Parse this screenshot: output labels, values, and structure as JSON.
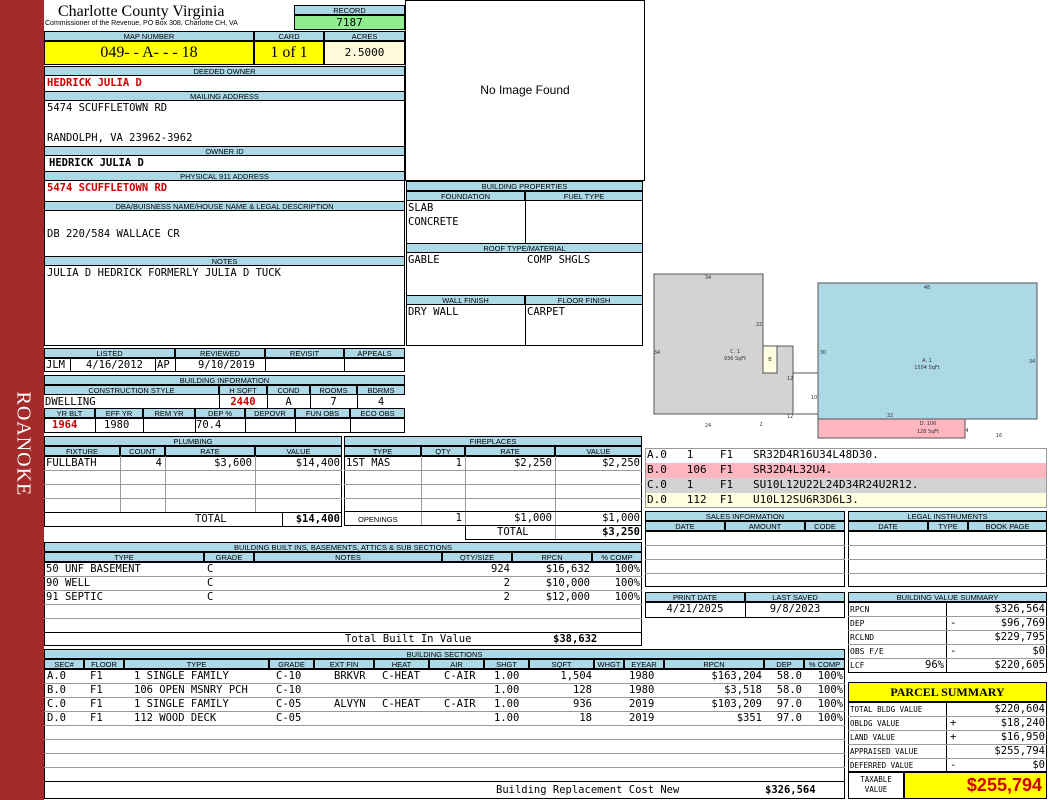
{
  "sidebar_label": "ROANOKE",
  "header": {
    "county": "Charlotte County Virginia",
    "commissioner": "Commissioner of the Revenue, PO Box 308, Charlotte CH, VA",
    "record_label": "RECORD",
    "record": "7187",
    "map_number_label": "MAP NUMBER",
    "map_number": "049- - A- - - 18",
    "card_label": "CARD",
    "card": "1 of 1",
    "acres_label": "ACRES",
    "acres": "2.5000"
  },
  "owner": {
    "deeded_owner_label": "DEEDED OWNER",
    "deeded_owner": "HEDRICK JULIA D",
    "mailing_label": "MAILING ADDRESS",
    "mailing_line1": "5474 SCUFFLETOWN RD",
    "mailing_line2": "RANDOLPH, VA 23962-3962",
    "owner_id_label": "OWNER ID",
    "owner_id": "HEDRICK JULIA D",
    "physical_label": "PHYSICAL 911 ADDRESS",
    "physical": "5474 SCUFFLETOWN RD",
    "dba_label": "DBA/BUISNESS NAME/HOUSE NAME & LEGAL DESCRIPTION",
    "dba": "DB 220/584 WALLACE CR",
    "notes_label": "NOTES",
    "notes": "JULIA D HEDRICK FORMERLY JULIA D TUCK"
  },
  "image_placeholder": "No Image Found",
  "building_props": {
    "title": "BUILDING PROPERTIES",
    "foundation_label": "FOUNDATION",
    "fuel_label": "FUEL TYPE",
    "foundation_1": "SLAB",
    "foundation_2": "CONCRETE",
    "roof_label": "ROOF TYPE/MATERIAL",
    "roof_type": "GABLE",
    "roof_material": "COMP SHGLS",
    "wall_label": "WALL FINISH",
    "floor_label": "FLOOR FINISH",
    "wall": "DRY WALL",
    "floor": "CARPET"
  },
  "listing": {
    "listed_label": "LISTED",
    "reviewed_label": "REVIEWED",
    "revisit_label": "REVISIT",
    "appeals_label": "APPEALS",
    "listed_by": "JLM",
    "listed_date": "4/16/2012",
    "reviewed_by": "AP",
    "reviewed_date": "9/10/2019"
  },
  "building_info": {
    "title": "BUILDING INFORMATION",
    "style_label": "CONSTRUCTION STYLE",
    "hsqft_label": "H SQFT",
    "cond_label": "COND",
    "rooms_label": "ROOMS",
    "bdrms_label": "BDRMS",
    "style": "DWELLING",
    "hsqft": "2440",
    "cond": "A",
    "rooms": "7",
    "bdrms": "4",
    "yrblt_label": "YR BLT",
    "effyr_label": "EFF YR",
    "remyr_label": "REM YR",
    "dep_label": "DEP %",
    "depovr_label": "DEPOVR",
    "funobs_label": "FUN OBS",
    "ecoobs_label": "ECO OBS",
    "yrblt": "1964",
    "effyr": "1980",
    "dep": "70.4"
  },
  "plumbing": {
    "title": "PLUMBING",
    "headers": [
      "FIXTURE",
      "COUNT",
      "RATE",
      "VALUE"
    ],
    "rows": [
      [
        "FULLBATH",
        "4",
        "$3,600",
        "$14,400"
      ]
    ],
    "total_label": "TOTAL",
    "total": "$14,400"
  },
  "fireplaces": {
    "title": "FIREPLACES",
    "headers": [
      "TYPE",
      "QTY",
      "RATE",
      "VALUE"
    ],
    "rows": [
      [
        "1ST MAS",
        "1",
        "$2,250",
        "$2,250"
      ]
    ],
    "openings_label": "OPENINGS",
    "openings_qty": "1",
    "openings_rate": "$1,000",
    "openings_value": "$1,000",
    "total_label": "TOTAL",
    "total": "$3,250"
  },
  "builtins": {
    "title": "BUILDING BUILT INS, BASEMENTS, ATTICS & SUB SECTIONS",
    "headers": [
      "TYPE",
      "GRADE",
      "NOTES",
      "QTY/SIZE",
      "RPCN",
      "% COMP"
    ],
    "rows": [
      [
        "50 UNF BASEMENT",
        "C",
        "",
        "924",
        "$16,632",
        "100%"
      ],
      [
        "90 WELL",
        "C",
        "",
        "2",
        "$10,000",
        "100%"
      ],
      [
        "91 SEPTIC",
        "C",
        "",
        "2",
        "$12,000",
        "100%"
      ]
    ],
    "total_label": "Total Built In Value",
    "total": "$38,632"
  },
  "sketch": {
    "labels": [
      "34",
      "22",
      "34",
      "C. 1",
      "936 SqFt",
      "B",
      "12",
      "10",
      "12",
      "24",
      "2",
      "48",
      "30",
      "34",
      "A. 1",
      "1504 SqFt",
      "32",
      "D. 106",
      "128 SqFt",
      "4",
      "16"
    ],
    "vectors": [
      {
        "text": "A.0   1    F1   SR32D4R16U34L48D30.",
        "color": "#ffffff"
      },
      {
        "text": "B.0   106  F1   SR32D4L32U4.",
        "color": "#ffb6c1"
      },
      {
        "text": "C.0   1    F1   SU10L12U22L24D34R24U2R12.",
        "color": "#d3d3d3"
      },
      {
        "text": "D.0   112  F1   U10L12SU6R3D6L3.",
        "color": "#ffffe0"
      }
    ]
  },
  "sales": {
    "title": "SALES INFORMATION",
    "headers": [
      "DATE",
      "AMOUNT",
      "CODE"
    ]
  },
  "legal": {
    "title": "LEGAL INSTRUMENTS",
    "headers": [
      "DATE",
      "TYPE",
      "BOOK PAGE"
    ]
  },
  "dates": {
    "print_label": "PRINT DATE",
    "print_date": "4/21/2025",
    "saved_label": "LAST SAVED",
    "saved_date": "9/8/2023"
  },
  "value_summary": {
    "title": "BUILDING VALUE SUMMARY",
    "rows": [
      {
        "label": "RPCN",
        "sign": "",
        "value": "$326,564"
      },
      {
        "label": "DEP",
        "sign": "-",
        "value": "$96,769"
      },
      {
        "label": "RCLND",
        "sign": "",
        "value": "$229,795"
      },
      {
        "label": "OBS F/E",
        "sign": "-",
        "value": "$0"
      },
      {
        "label": "LCF",
        "sign": "96%",
        "value": "$220,605"
      }
    ]
  },
  "parcel_summary": {
    "title": "PARCEL SUMMARY",
    "rows": [
      {
        "label": "TOTAL BLDG VALUE",
        "sign": "",
        "value": "$220,604"
      },
      {
        "label": "OBLDG VALUE",
        "sign": "+",
        "value": "$18,240"
      },
      {
        "label": "LAND VALUE",
        "sign": "+",
        "value": "$16,950"
      },
      {
        "label": "APPRAISED VALUE",
        "sign": "",
        "value": "$255,794"
      },
      {
        "label": "DEFERRED VALUE",
        "sign": "-",
        "value": "$0"
      }
    ],
    "taxable_label_1": "TAXABLE",
    "taxable_label_2": "VALUE",
    "taxable": "$255,794"
  },
  "sections": {
    "title": "BUILDING SECTIONS",
    "headers": [
      "SEC#",
      "FLOOR",
      "TYPE",
      "GRADE",
      "EXT FIN",
      "HEAT",
      "AIR",
      "SHGT",
      "SQFT",
      "WHGT",
      "EYEAR",
      "RPCN",
      "DEP",
      "% COMP"
    ],
    "rows": [
      [
        "A.0",
        "F1",
        "1 SINGLE FAMILY",
        "C-10",
        "BRKVR",
        "C-HEAT",
        "C-AIR",
        "1.00",
        "1,504",
        "",
        "1980",
        "$163,204",
        "58.0",
        "100%"
      ],
      [
        "B.0",
        "F1",
        "106 OPEN MSNRY PCH",
        "C-10",
        "",
        "",
        "",
        "1.00",
        "128",
        "",
        "1980",
        "$3,518",
        "58.0",
        "100%"
      ],
      [
        "C.0",
        "F1",
        "1 SINGLE FAMILY",
        "C-05",
        "ALVYN",
        "C-HEAT",
        "C-AIR",
        "1.00",
        "936",
        "",
        "2019",
        "$103,209",
        "97.0",
        "100%"
      ],
      [
        "D.0",
        "F1",
        "112 WOOD DECK",
        "C-05",
        "",
        "",
        "",
        "1.00",
        "18",
        "",
        "2019",
        "$351",
        "97.0",
        "100%"
      ]
    ],
    "total_label": "Building Replacement Cost New",
    "total": "$326,564"
  }
}
